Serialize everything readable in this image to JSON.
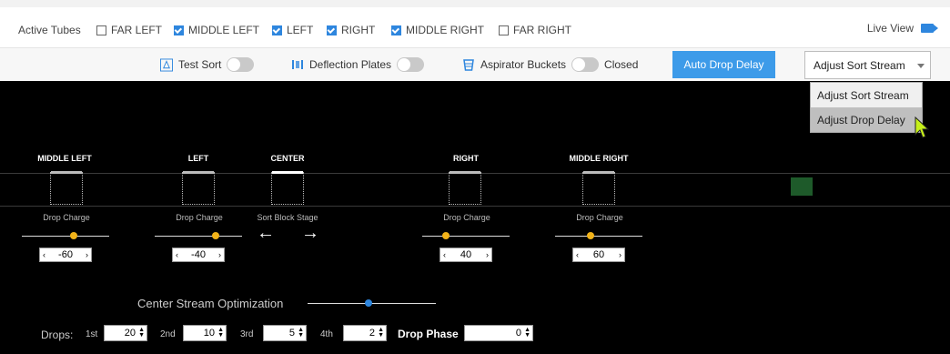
{
  "tubes": {
    "title": "Active Tubes",
    "items": [
      {
        "label": "FAR LEFT",
        "checked": false
      },
      {
        "label": "MIDDLE LEFT",
        "checked": true
      },
      {
        "label": "LEFT",
        "checked": true
      },
      {
        "label": "RIGHT",
        "checked": true
      },
      {
        "label": "MIDDLE RIGHT",
        "checked": true
      },
      {
        "label": "FAR RIGHT",
        "checked": false
      }
    ],
    "live_view": "Live View"
  },
  "toolbar": {
    "test_sort": "Test Sort",
    "deflection_plates": "Deflection Plates",
    "aspirator_buckets": "Aspirator Buckets",
    "closed": "Closed",
    "auto_drop_delay": "Auto Drop Delay",
    "select_value": "Adjust Sort Stream"
  },
  "menu": {
    "items": [
      "Adjust Sort Stream",
      "Adjust Drop Delay"
    ],
    "hovered": "Adjust Drop Delay"
  },
  "streams": {
    "middle_left": {
      "label": "MIDDLE LEFT",
      "sub": "Drop Charge",
      "value": "-60"
    },
    "left": {
      "label": "LEFT",
      "sub": "Drop Charge",
      "value": "-40"
    },
    "center": {
      "label": "CENTER",
      "sub": "Sort Block Stage"
    },
    "right": {
      "label": "RIGHT",
      "sub": "Drop Charge",
      "value": "40"
    },
    "middle_right": {
      "label": "MIDDLE RIGHT",
      "sub": "Drop Charge",
      "value": "60"
    }
  },
  "optimization": {
    "label": "Center Stream Optimization"
  },
  "drops": {
    "label": "Drops:",
    "first_label": "1st",
    "first": "20",
    "second_label": "2nd",
    "second": "10",
    "third_label": "3rd",
    "third": "5",
    "fourth_label": "4th",
    "fourth": "2",
    "phase_label": "Drop Phase",
    "phase": "0"
  },
  "colors": {
    "accent": "#3d9be9",
    "slider_thumb": "#f2b319",
    "background_stage": "#000000"
  }
}
